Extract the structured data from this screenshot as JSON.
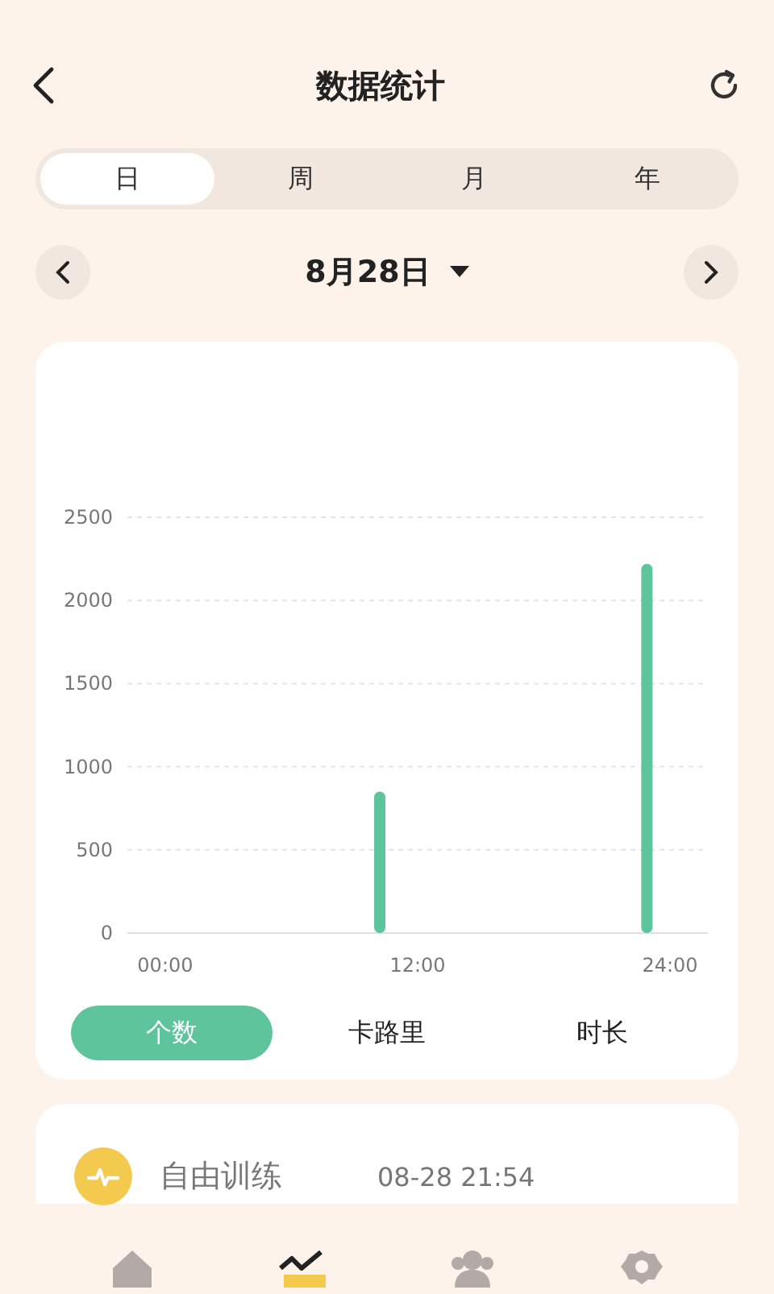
{
  "header": {
    "title": "数据统计"
  },
  "periods": [
    {
      "label": "日",
      "selected": true
    },
    {
      "label": "周",
      "selected": false
    },
    {
      "label": "月",
      "selected": false
    },
    {
      "label": "年",
      "selected": false
    }
  ],
  "date": {
    "label": "8月28日"
  },
  "chart_card": {
    "chart_data": {
      "type": "bar",
      "x": [
        10.2,
        22.9
      ],
      "series": [
        {
          "color": "#5ec49b",
          "values": [
            850,
            2220
          ]
        }
      ],
      "xlim": [
        -1.8,
        25.8
      ],
      "ylim": [
        0,
        2500
      ],
      "grid": true,
      "yticks": [
        0,
        500,
        1000,
        1500,
        2000,
        2500
      ],
      "xticks": [
        {
          "value": 0,
          "label": "00:00"
        },
        {
          "value": 12,
          "label": "12:00"
        },
        {
          "value": 24,
          "label": "24:00"
        }
      ]
    }
  },
  "metrics": [
    {
      "label": "个数",
      "selected": true
    },
    {
      "label": "卡路里",
      "selected": false
    },
    {
      "label": "时长",
      "selected": false
    }
  ],
  "records": [
    {
      "name": "自由训练",
      "time": "08-28 21:54"
    }
  ],
  "nav": [
    {
      "kind": "home",
      "selected": false
    },
    {
      "kind": "stats",
      "selected": true
    },
    {
      "kind": "people",
      "selected": false
    },
    {
      "kind": "settings",
      "selected": false
    }
  ]
}
